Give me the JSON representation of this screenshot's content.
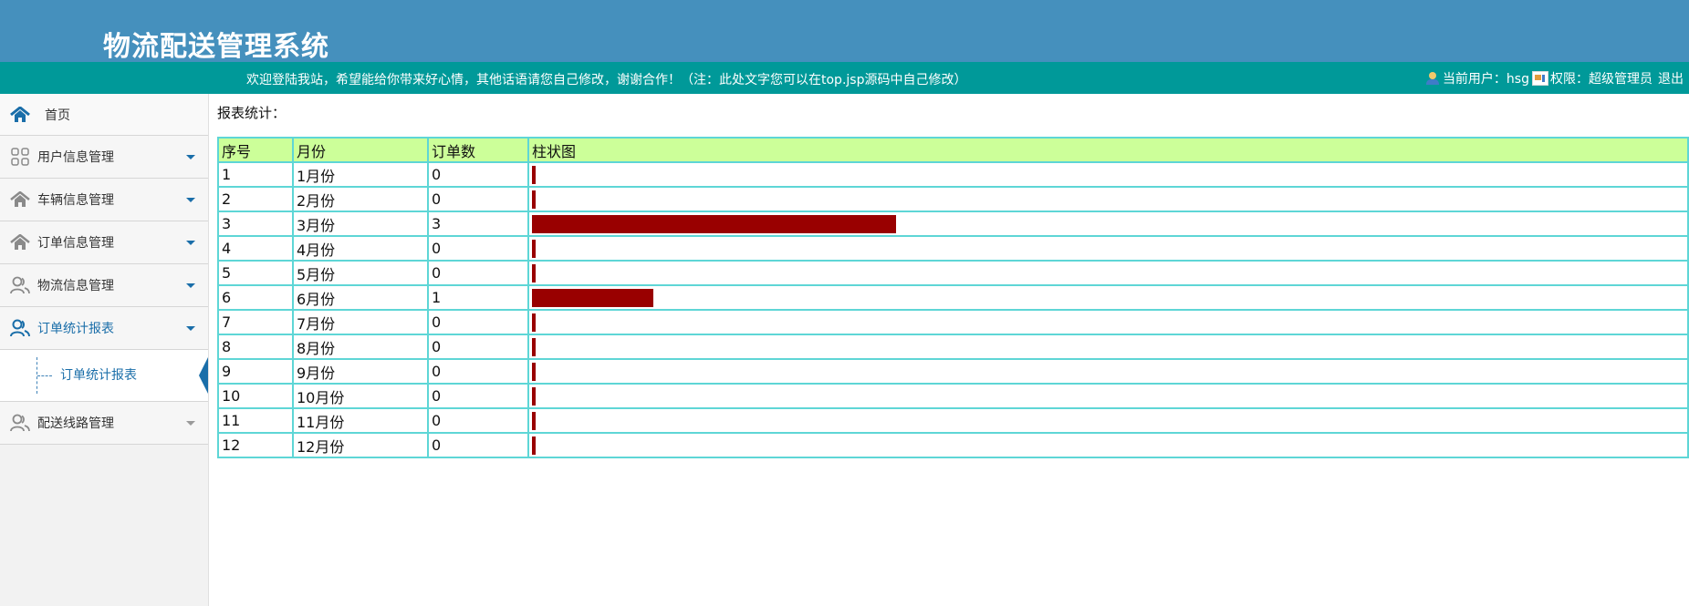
{
  "header": {
    "title": "物流配送管理系统",
    "welcome": "欢迎登陆我站，希望能给你带来好心情，其他话语请您自己修改，谢谢合作！（注：此处文字您可以在top.jsp源码中自己修改）",
    "user_label": "当前用户：hsg",
    "perm_label": "权限：超级管理员",
    "logout_label": "退出"
  },
  "sidebar": {
    "items": [
      {
        "label": "首页",
        "icon": "home-icon"
      },
      {
        "label": "用户信息管理",
        "icon": "grid-icon"
      },
      {
        "label": "车辆信息管理",
        "icon": "house-icon"
      },
      {
        "label": "订单信息管理",
        "icon": "house-icon"
      },
      {
        "label": "物流信息管理",
        "icon": "users-icon"
      },
      {
        "label": "订单统计报表",
        "icon": "users-icon"
      },
      {
        "label": "配送线路管理",
        "icon": "users-icon"
      }
    ],
    "submenu_label": "订单统计报表"
  },
  "main": {
    "report_title": "报表统计：",
    "columns": [
      "序号",
      "月份",
      "订单数",
      "柱状图"
    ],
    "rows": [
      {
        "no": "1",
        "month": "1月份",
        "count": "0"
      },
      {
        "no": "2",
        "month": "2月份",
        "count": "0"
      },
      {
        "no": "3",
        "month": "3月份",
        "count": "3"
      },
      {
        "no": "4",
        "month": "4月份",
        "count": "0"
      },
      {
        "no": "5",
        "month": "5月份",
        "count": "0"
      },
      {
        "no": "6",
        "month": "6月份",
        "count": "1"
      },
      {
        "no": "7",
        "month": "7月份",
        "count": "0"
      },
      {
        "no": "8",
        "month": "8月份",
        "count": "0"
      },
      {
        "no": "9",
        "month": "9月份",
        "count": "0"
      },
      {
        "no": "10",
        "month": "10月份",
        "count": "0"
      },
      {
        "no": "11",
        "month": "11月份",
        "count": "0"
      },
      {
        "no": "12",
        "month": "12月份",
        "count": "0"
      }
    ]
  },
  "colors": {
    "header_bg": "#4590bd",
    "topbar_bg": "#009999",
    "table_header_bg": "#ccff99",
    "table_border": "#5ed6d6",
    "bar_color": "#990000",
    "accent": "#1a6ea9"
  }
}
